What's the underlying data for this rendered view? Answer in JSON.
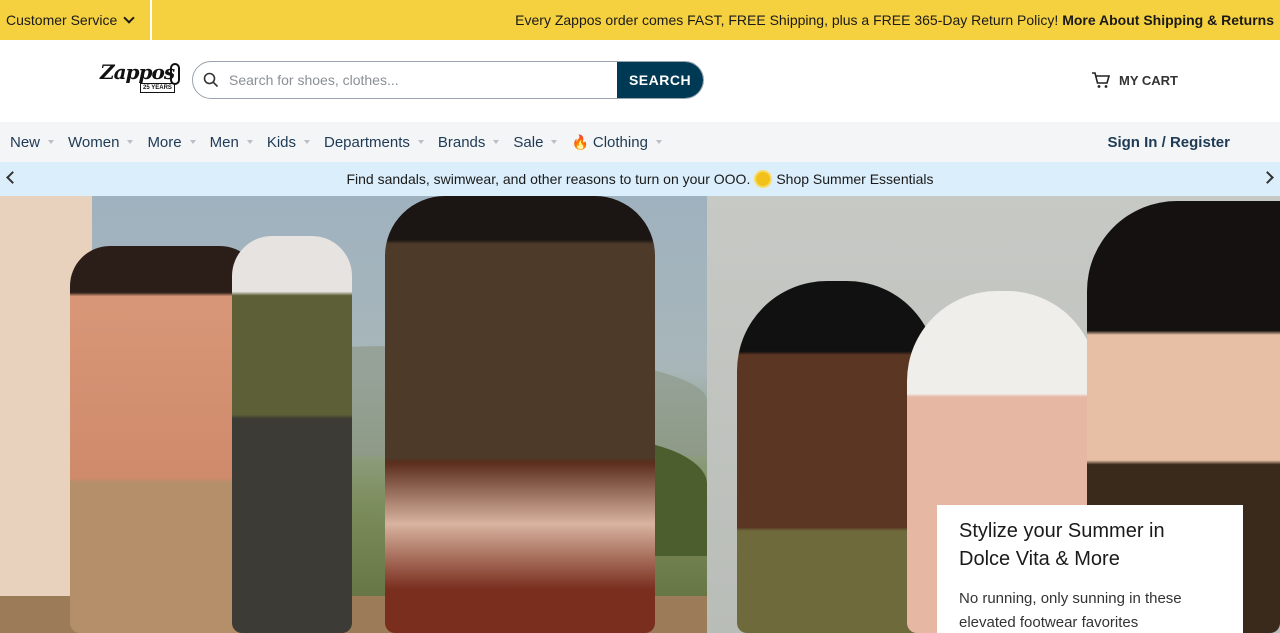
{
  "topbar": {
    "customer_service": "Customer Service",
    "promo_text": "Every Zappos order comes FAST, FREE Shipping, plus a FREE 365-Day Return Policy!",
    "promo_link": "More About Shipping & Returns"
  },
  "header": {
    "logo_text": "Zappos",
    "logo_badge": "25 YEARS",
    "search_placeholder": "Search for shoes, clothes...",
    "search_button": "SEARCH",
    "cart_label": "MY CART"
  },
  "nav": {
    "items": [
      "New",
      "Women",
      "More",
      "Men",
      "Kids",
      "Departments",
      "Brands",
      "Sale",
      "Clothing"
    ],
    "sign_in": "Sign In / Register"
  },
  "strip": {
    "text": "Find sandals, swimwear, and other reasons to turn on your OOO.",
    "link": "Shop Summer Essentials"
  },
  "hero": {
    "card_title": "Stylize your Summer in Dolce Vita & More",
    "card_desc": "No running, only sunning in these elevated footwear favorites"
  },
  "colors": {
    "topbar_bg": "#f6d13f",
    "search_button_bg": "#003953",
    "nav_text": "#1f3a55",
    "strip_bg": "#dbeefb"
  }
}
